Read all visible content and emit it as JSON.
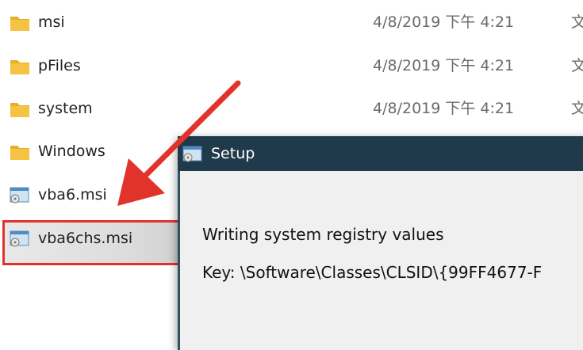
{
  "files": [
    {
      "name": "msi",
      "date": "4/8/2019 下午 4:21",
      "type": "文",
      "icon": "folder-icon"
    },
    {
      "name": "pFiles",
      "date": "4/8/2019 下午 4:21",
      "type": "文",
      "icon": "folder-icon"
    },
    {
      "name": "system",
      "date": "4/8/2019 下午 4:21",
      "type": "文",
      "icon": "folder-icon"
    },
    {
      "name": "Windows",
      "icon": "folder-icon"
    },
    {
      "name": "vba6.msi",
      "icon": "msi-installer-icon"
    },
    {
      "name": "vba6chs.msi",
      "icon": "msi-installer-icon",
      "selected": true
    }
  ],
  "setup": {
    "title": "Setup",
    "status": "Writing system registry values",
    "key": "Key: \\Software\\Classes\\CLSID\\{99FF4677-F"
  },
  "colors": {
    "highlight": "#e2332b",
    "titlebar": "#1f3a4b",
    "folder": "#f5c242"
  }
}
